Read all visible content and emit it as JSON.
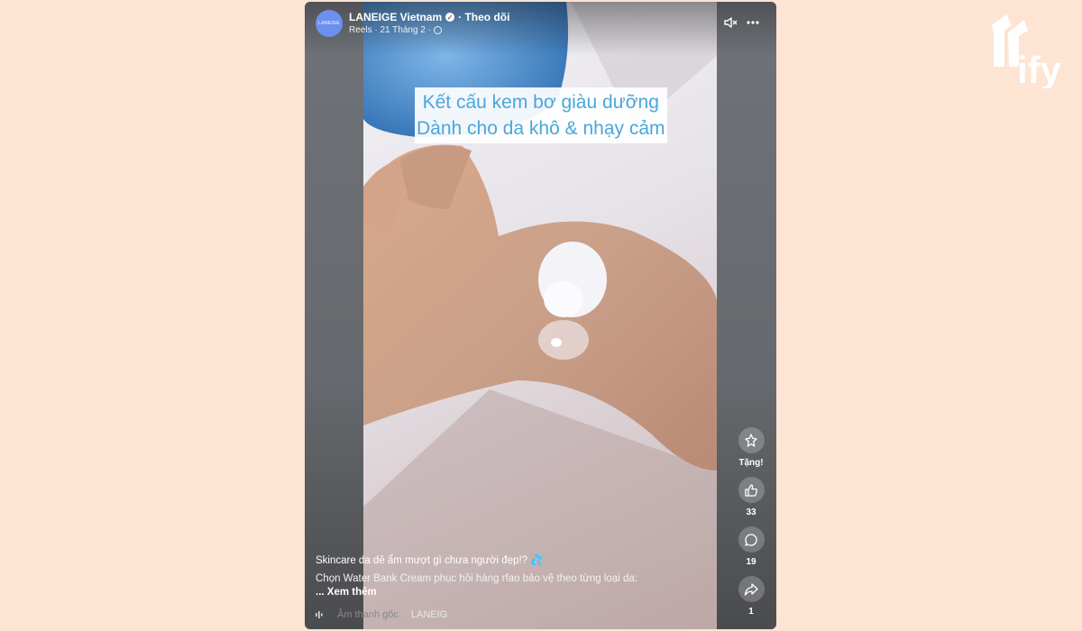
{
  "post": {
    "avatar_text": "LANEIGE",
    "page_name": "LANEIGE Vietnam",
    "follow_label": "· Theo dõi",
    "meta_text": "Reels · 21 Tháng 2 ·"
  },
  "video": {
    "caption_line1": "Kết cấu kem bơ giàu dưỡng",
    "caption_line2": "Dành cho da khô & nhạy cảm"
  },
  "actions": {
    "gift_label": "Tặng!",
    "like_count": "33",
    "comment_count": "19",
    "share_count": "1"
  },
  "description": {
    "line1": "Skincare da dẻ ẩm mượt gì chưa người đẹp!? 💦",
    "line2": "Chọn Water Bank Cream phục hồi hàng rfao bảo vệ theo từng loại da:",
    "see_more": "... Xem thêm"
  },
  "audio": {
    "name": "Âm thanh gốc",
    "tag": "LANEIG"
  },
  "brand": {
    "watermark": "ify",
    "accent_color": "#4aa6dc",
    "background_color": "#fde4d3"
  }
}
